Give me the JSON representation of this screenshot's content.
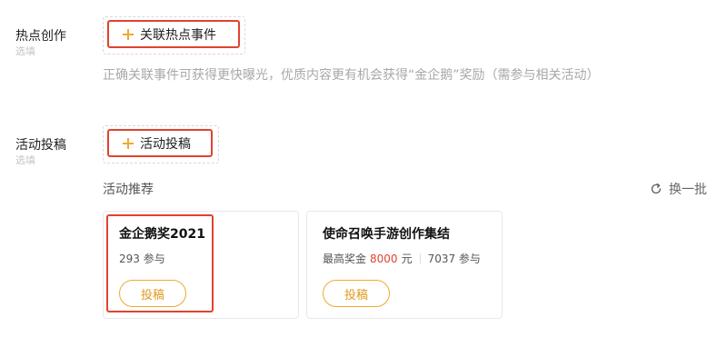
{
  "hot_creation": {
    "label": "热点创作",
    "optional": "选填",
    "button_label": "关联热点事件",
    "button_icon": "plus-icon",
    "hint": "正确关联事件可获得更快曝光，优质内容更有机会获得“金企鹅”奖励（需参与相关活动）"
  },
  "activity_submission": {
    "label": "活动投稿",
    "optional": "选填",
    "button_label": "活动投稿",
    "button_icon": "plus-icon",
    "recommend_title": "活动推荐",
    "refresh_label": "换一批",
    "refresh_icon": "refresh-icon",
    "cards": [
      {
        "title": "金企鹅奖2021",
        "participants": "293 参与",
        "submit_label": "投稿"
      },
      {
        "title": "使命召唤手游创作集结",
        "prize_prefix": "最高奖金",
        "prize_amount": "8000",
        "prize_unit": "元",
        "participants": "7037 参与",
        "submit_label": "投稿"
      }
    ]
  },
  "colors": {
    "accent_red": "#e0432f",
    "accent_orange": "#f0a830",
    "hint_gray": "#a8a8a8"
  }
}
